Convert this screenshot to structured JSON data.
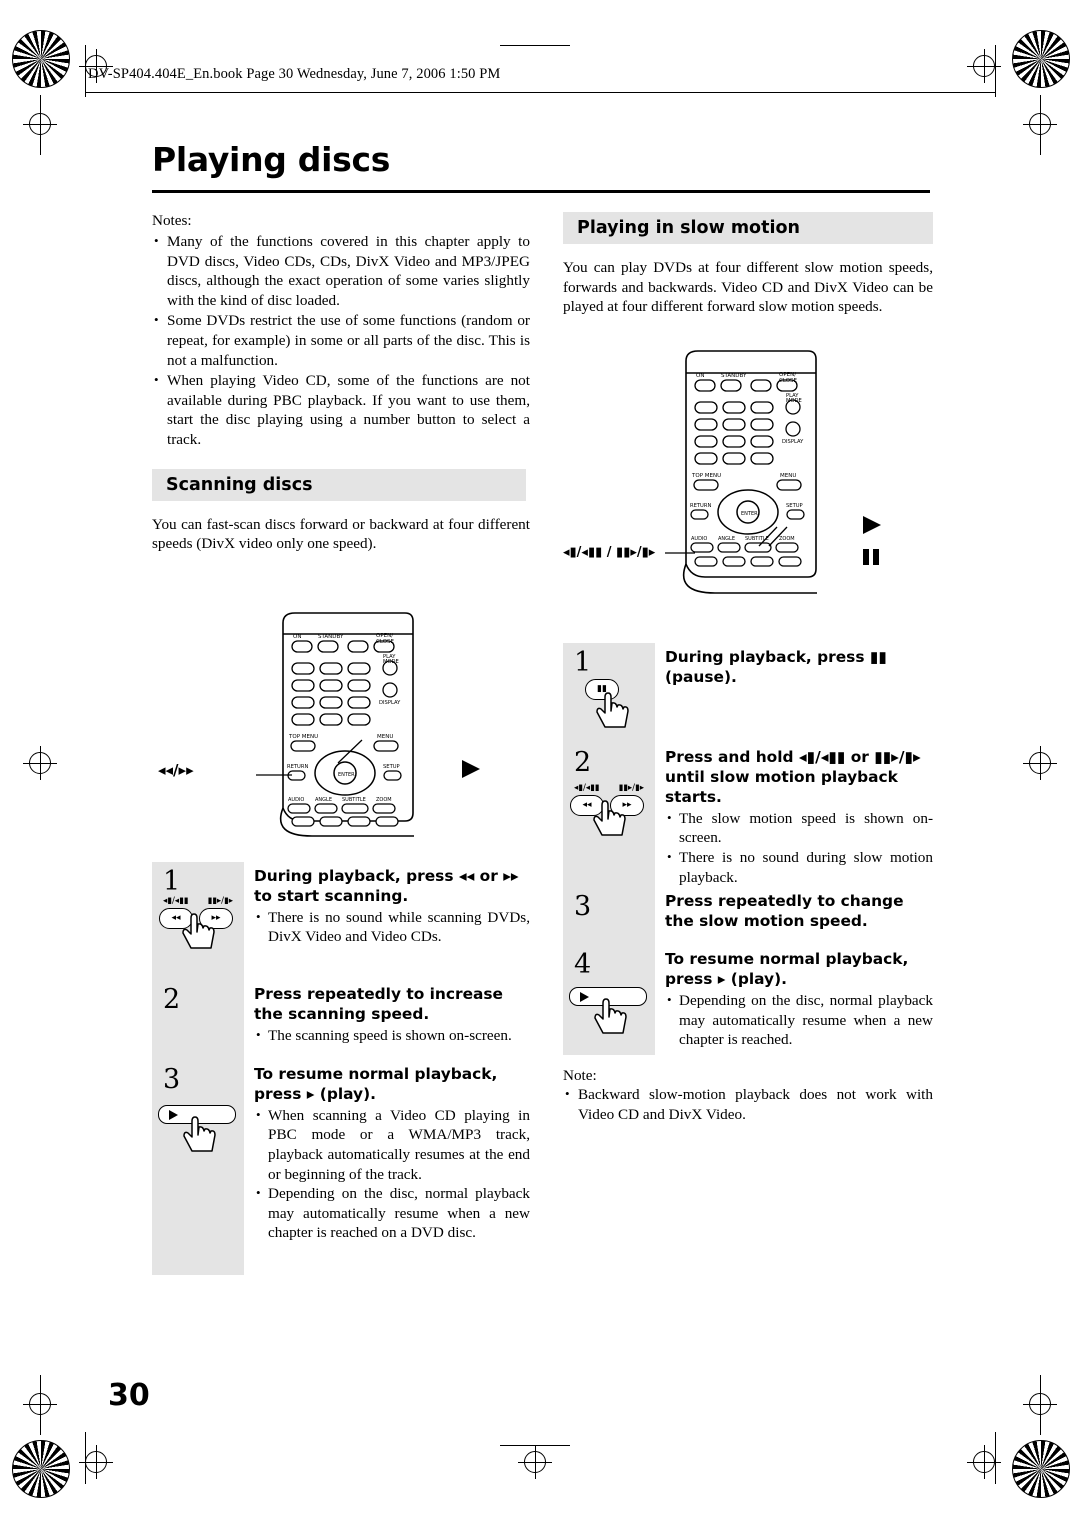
{
  "header": {
    "text": "DV-SP404.404E_En.book  Page 30  Wednesday, June 7, 2006  1:50 PM"
  },
  "page": {
    "title": "Playing discs",
    "number": "30"
  },
  "left_column": {
    "notes_label": "Notes:",
    "notes": [
      "Many of the functions covered in this chapter apply to DVD discs, Video CDs, CDs, DivX Video and MP3/JPEG discs, although the exact operation of some varies slightly with the kind of disc loaded.",
      "Some DVDs restrict the use of some functions (random or repeat, for example) in some or all parts of the disc. This is not a malfunction.",
      "When playing Video CD, some of the functions are not available during PBC playback. If you want to use them, start the disc playing using a number button to select a track."
    ],
    "section_heading": "Scanning discs",
    "intro": "You can fast-scan discs forward or backward at four different speeds (DivX video only one speed).",
    "remote_callout": "◂◂/▸▸",
    "steps": [
      {
        "num": "1",
        "title": "During playback, press ◂◂ or ▸▸ to start scanning.",
        "bullets": [
          "There is no sound while scanning DVDs, DivX Video and Video CDs."
        ],
        "button_labels": [
          "◂▮/◂▮▮",
          "▮▮▸/▮▸"
        ],
        "buttons": [
          "◂◂",
          "▸▸"
        ]
      },
      {
        "num": "2",
        "title": "Press repeatedly to increase the scanning speed.",
        "bullets": [
          "The scanning speed is shown on-screen."
        ]
      },
      {
        "num": "3",
        "title": "To resume normal playback, press ▸ (play).",
        "bullets": [
          "When scanning a Video CD playing in PBC mode or a WMA/MP3 track, playback automatically resumes at the end or beginning of the track.",
          "Depending on the disc, normal playback may automatically resume when a new chapter is reached on a DVD disc."
        ]
      }
    ]
  },
  "right_column": {
    "section_heading": "Playing in slow motion",
    "intro": "You can play DVDs at four different slow motion speeds, forwards and backwards. Video CD and DivX Video can be played at four different forward slow motion speeds.",
    "remote_callout": "◂▮/◂▮▮ / ▮▮▸/▮▸",
    "steps": [
      {
        "num": "1",
        "title": "During playback, press ▮▮ (pause).",
        "bullets": [],
        "button_labels": [],
        "buttons": [
          "▮▮"
        ]
      },
      {
        "num": "2",
        "title": "Press and hold ◂▮/◂▮▮ or ▮▮▸/▮▸ until slow motion playback starts.",
        "bullets": [
          "The slow motion speed is shown on-screen.",
          "There is no sound during slow motion playback."
        ],
        "button_labels": [
          "◂▮/◂▮▮",
          "▮▮▸/▮▸"
        ],
        "buttons": [
          "◂◂",
          "▸▸"
        ]
      },
      {
        "num": "3",
        "title": "Press repeatedly to change the slow motion speed.",
        "bullets": []
      },
      {
        "num": "4",
        "title": "To resume normal playback, press ▸ (play).",
        "bullets": [
          "Depending on the disc, normal playback may automatically resume when a new chapter is reached."
        ]
      }
    ],
    "note_label": "Note:",
    "notes": [
      "Backward slow-motion playback does not work with Video CD and DivX Video."
    ],
    "play_marker": "▸",
    "pause_marker": "▮▮"
  },
  "remote": {
    "top_labels": [
      "ON",
      "STANDBY",
      "OPEN/",
      "CLOSE"
    ],
    "right_labels": [
      "PLAY",
      "MODE",
      "DISPLAY"
    ],
    "menu_labels": [
      "TOP MENU",
      "MENU"
    ],
    "nav_labels": [
      "RETURN",
      "SETUP",
      "ENTER"
    ],
    "bottom_labels": [
      "AUDIO",
      "ANGLE",
      "SUBTITLE",
      "ZOOM"
    ]
  }
}
